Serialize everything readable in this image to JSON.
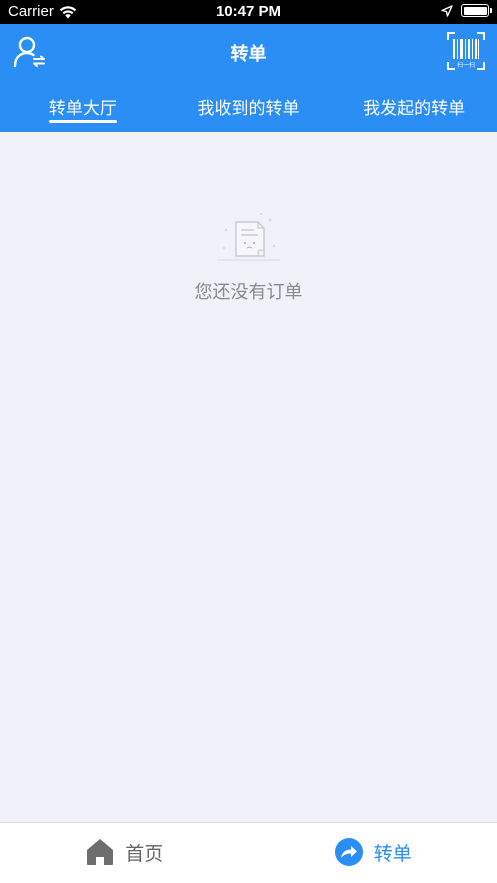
{
  "status_bar": {
    "carrier": "Carrier",
    "time": "10:47 PM"
  },
  "navbar": {
    "title": "转单",
    "left_icon": "user-switch-icon",
    "right_icon": "barcode-scan-icon",
    "scan_label": "扫一扫"
  },
  "tabs": [
    {
      "label": "转单大厅",
      "active": true
    },
    {
      "label": "我收到的转单",
      "active": false
    },
    {
      "label": "我发起的转单",
      "active": false
    }
  ],
  "empty_state": {
    "message": "您还没有订单",
    "icon": "empty-document-icon"
  },
  "tabbar": [
    {
      "label": "首页",
      "icon": "home-icon",
      "active": false
    },
    {
      "label": "转单",
      "icon": "share-arrow-icon",
      "active": true
    }
  ],
  "colors": {
    "primary": "#2a8ef5",
    "background": "#f1f1f9",
    "muted_text": "#8a8a8a"
  }
}
